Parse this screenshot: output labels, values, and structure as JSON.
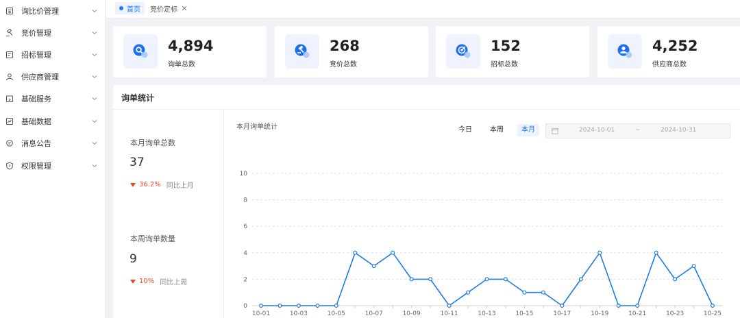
{
  "sidebar": {
    "items": [
      {
        "label": "询比价管理",
        "icon": "document-search-icon"
      },
      {
        "label": "竞价管理",
        "icon": "gavel-icon"
      },
      {
        "label": "招标管理",
        "icon": "file-list-icon"
      },
      {
        "label": "供应商管理",
        "icon": "user-icon"
      },
      {
        "label": "基础服务",
        "icon": "box-icon"
      },
      {
        "label": "基础数据",
        "icon": "chart-box-icon"
      },
      {
        "label": "消息公告",
        "icon": "message-icon"
      },
      {
        "label": "权限管理",
        "icon": "shield-icon"
      }
    ]
  },
  "tabs": {
    "home": "首页",
    "bid_award": "竞价定标"
  },
  "cards": [
    {
      "value": "4,894",
      "label": "询单总数",
      "icon": "search-icon"
    },
    {
      "value": "268",
      "label": "竞价总数",
      "icon": "gavel-icon"
    },
    {
      "value": "152",
      "label": "招标总数",
      "icon": "target-icon"
    },
    {
      "value": "4,252",
      "label": "供应商总数",
      "icon": "users-icon"
    }
  ],
  "panel": {
    "title": "询单统计",
    "month": {
      "label": "本月询单总数",
      "value": "37",
      "pct": "36.2%",
      "compare": "同比上月"
    },
    "week": {
      "label": "本周询单数量",
      "value": "9",
      "pct": "10%",
      "compare": "同比上周"
    },
    "chart_title": "本月询单统计",
    "range": {
      "today": "今日",
      "week": "本周",
      "month": "本月",
      "active": "month"
    },
    "date_start": "2024-10-01",
    "date_sep": "~",
    "date_end": "2024-10-31"
  },
  "colors": {
    "accent": "#1677ff",
    "line": "#1e7ce8",
    "down": "#e8492d"
  },
  "chart_data": {
    "type": "line",
    "x": [
      "10-01",
      "10-02",
      "10-03",
      "10-04",
      "10-05",
      "10-06",
      "10-07",
      "10-08",
      "10-09",
      "10-10",
      "10-11",
      "10-12",
      "10-13",
      "10-14",
      "10-15",
      "10-16",
      "10-17",
      "10-18",
      "10-19",
      "10-20",
      "10-21",
      "10-22",
      "10-23",
      "10-24",
      "10-25"
    ],
    "tick_labels": [
      "10-01",
      "10-03",
      "10-05",
      "10-07",
      "10-09",
      "10-11",
      "10-13",
      "10-15",
      "10-17",
      "10-19",
      "10-21",
      "10-23",
      "10-25"
    ],
    "series": [
      {
        "values": [
          0,
          0,
          0,
          0,
          0,
          4,
          3,
          4,
          2,
          2,
          0,
          1,
          2,
          2,
          1,
          1,
          0,
          2,
          4,
          0,
          0,
          4,
          2,
          3,
          0
        ]
      }
    ],
    "yticks": [
      0,
      2,
      4,
      6,
      8,
      10
    ],
    "ylim": [
      0,
      10
    ],
    "grid": true,
    "title": "本月询单统计"
  }
}
